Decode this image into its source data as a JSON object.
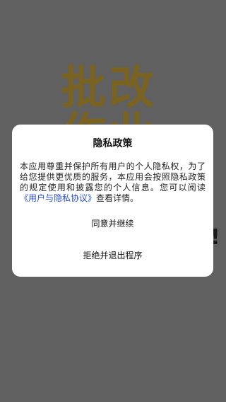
{
  "background": {
    "logo_line1": "批改",
    "logo_line2": "作业",
    "side_mark": "!"
  },
  "dialog": {
    "title": "隐私政策",
    "body_intro": "本应用尊重并保护所有用户的个人隐私权，为了给您提供更优质的服务，本应用会按照隐私政策的规定使用和披露您的个人信息。您可以阅读",
    "link_text": "《用户与隐私协议》",
    "body_outro": "查看详情。",
    "agree_label": "同意并继续",
    "refuse_label": "拒绝并退出程序"
  },
  "colors": {
    "overlay": "#606060",
    "dialog_bg": "#ffffff",
    "link": "#2a4ed8",
    "logo": "#7a6320"
  }
}
